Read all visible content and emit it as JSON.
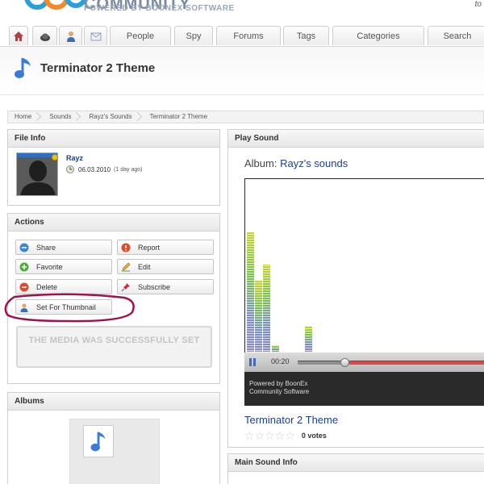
{
  "header": {
    "logo_text": "COMMUNITY",
    "logo_sub": "POWERED BY BOONEX SOFTWARE",
    "top_right": "to"
  },
  "nav": {
    "icon_tabs": [
      "home-icon",
      "profile-icon",
      "person-icon",
      "mail-icon"
    ],
    "tabs": [
      "People",
      "Spy",
      "Forums",
      "Tags",
      "Categories",
      "Search"
    ]
  },
  "page": {
    "title": "Terminator 2 Theme"
  },
  "breadcrumb": [
    "Home",
    "Sounds",
    "Rayz's Sounds",
    "Terminator 2 Theme"
  ],
  "file_info": {
    "heading": "File Info",
    "owner": "Rayz",
    "date": "06.03.2010",
    "date_ago": "(1 day ago)"
  },
  "actions": {
    "heading": "Actions",
    "share": "Share",
    "report": "Report",
    "favorite": "Favorite",
    "edit": "Edit",
    "delete": "Delete",
    "subscribe": "Subscribe",
    "set_thumbnail": "Set For Thumbnail",
    "success_message": "THE MEDIA WAS SUCCESSFULLY SET"
  },
  "albums": {
    "heading": "Albums"
  },
  "play_sound": {
    "heading": "Play Sound",
    "album_prefix": "Album:",
    "album_name": "Rayz's sounds",
    "time": "00:20",
    "progress": 0.24,
    "powered_line1": "Powered by BoonEx",
    "powered_line2": "Community Software",
    "sound_title": "Terminator 2 Theme",
    "rating": 0,
    "votes": "0 votes"
  },
  "main_sound_info": {
    "heading": "Main Sound Info"
  },
  "colors": {
    "link": "#1c3f8e",
    "accent_red": "#d94a4a",
    "annotation": "#a0124a"
  }
}
